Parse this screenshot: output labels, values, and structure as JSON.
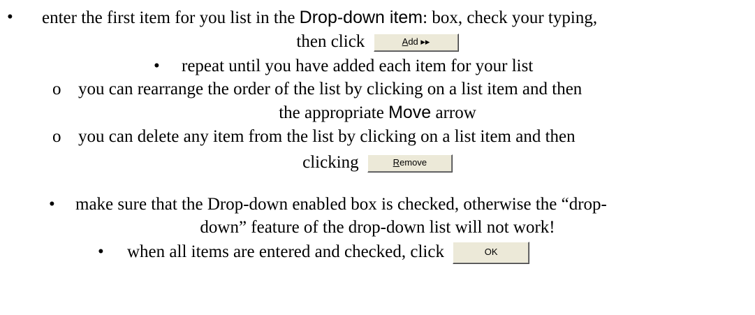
{
  "bullets": {
    "filled": "•",
    "hollow": "o"
  },
  "line1": {
    "pre": "enter the first item for you list in the ",
    "ui_label": "Drop-down item",
    "post": ": box, check your typing,"
  },
  "line2": {
    "pre": "then click",
    "button": {
      "underline": "A",
      "rest": "dd ▸▸"
    }
  },
  "line3": "repeat until you have added each item for your list",
  "line4": "you can rearrange the order of the list by clicking on a list item and then",
  "line5": {
    "pre": "the appropriate ",
    "ui_label": "Move",
    "post": " arrow"
  },
  "line6": "you can delete any item from the list by clicking on a list item and then",
  "line7": {
    "pre": "clicking",
    "button": {
      "underline": "R",
      "rest": "emove"
    }
  },
  "line8": "make sure that the Drop-down enabled box is checked, otherwise the “drop-",
  "line9": "down” feature of the drop-down list will not work!",
  "line10": {
    "pre": "when all items are entered and checked, click",
    "button": "OK"
  }
}
